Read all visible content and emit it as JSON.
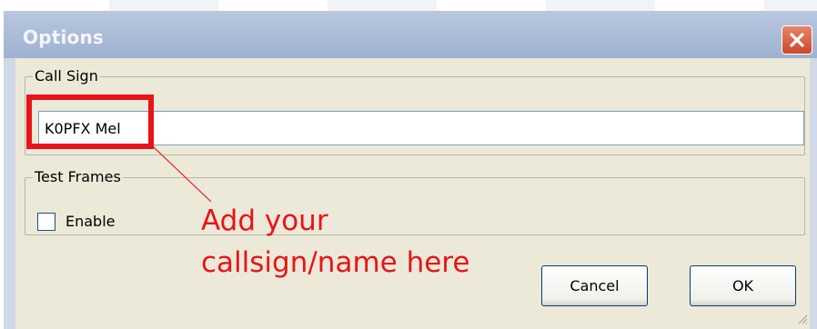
{
  "window": {
    "title": "Options",
    "close_icon": "close-icon"
  },
  "call_sign_group": {
    "legend": "Call Sign",
    "input_value": "K0PFX Mel"
  },
  "test_frames_group": {
    "legend": "Test Frames",
    "enable_label": "Enable",
    "enable_checked": false
  },
  "buttons": {
    "cancel": "Cancel",
    "ok": "OK"
  },
  "annotation": {
    "line1": "Add your",
    "line2": "callsign/name here",
    "color": "#e8141a"
  }
}
